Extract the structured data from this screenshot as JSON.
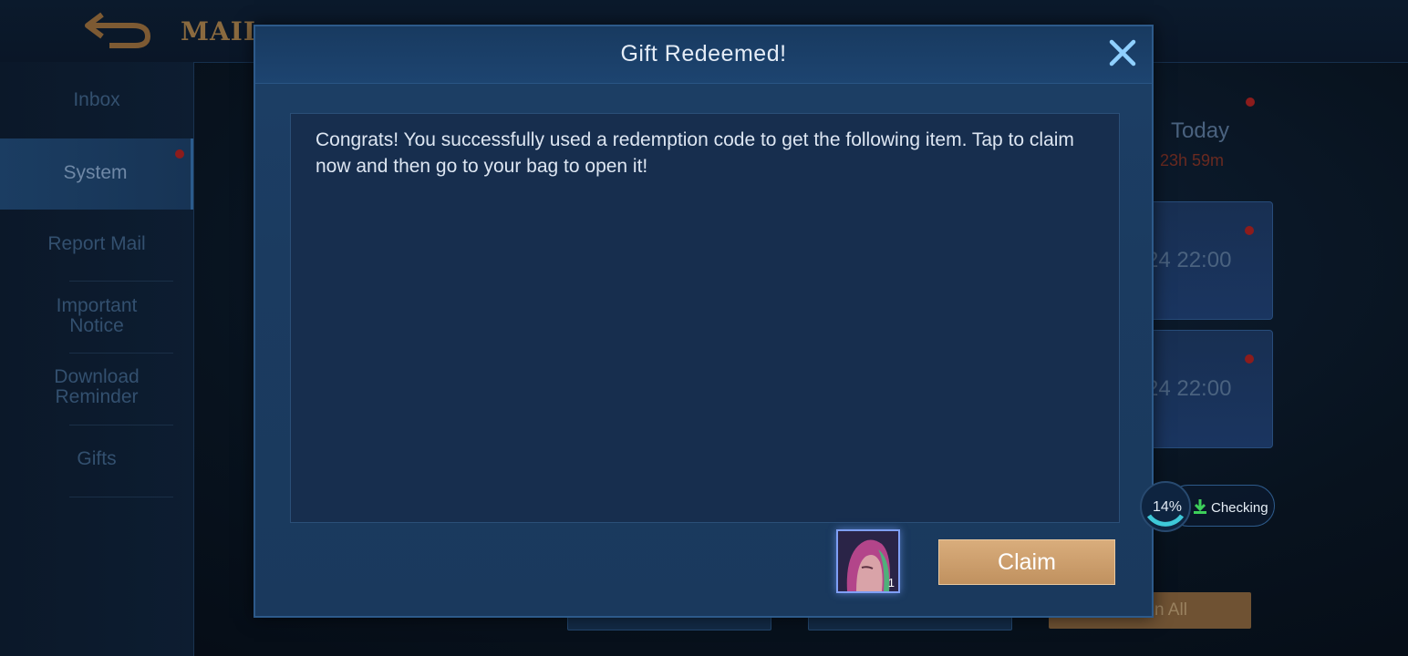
{
  "background": {
    "header": {
      "title": "MAIL"
    },
    "sidebar": {
      "items": [
        {
          "label": "Inbox"
        },
        {
          "label": "System"
        },
        {
          "label": "Report Mail"
        },
        {
          "label": "Important Notice"
        },
        {
          "label": "Download Reminder"
        },
        {
          "label": "Gifts"
        }
      ]
    },
    "mail_list": {
      "first": {
        "time": "Today",
        "countdown": "23h 59m"
      },
      "second": {
        "time": "24 22:00"
      },
      "third": {
        "time": "24 22:00"
      }
    },
    "bottom": {
      "claim_all_label": "n All"
    }
  },
  "modal": {
    "title": "Gift Redeemed!",
    "message": "Congrats! You successfully used a redemption code to get the following item. Tap to claim now and then go to your bag to open it!",
    "item": {
      "icon": "hero-portrait-icon",
      "quantity": "1"
    },
    "claim_label": "Claim"
  },
  "download": {
    "percent": "14%",
    "status": "Checking"
  },
  "colors": {
    "accent_gold": "#c9996a",
    "modal_bg": "#1b3b60",
    "close_icon": "#8fd0ff",
    "download_icon": "#3dcf5a",
    "download_ring": "#3ec8d8"
  }
}
